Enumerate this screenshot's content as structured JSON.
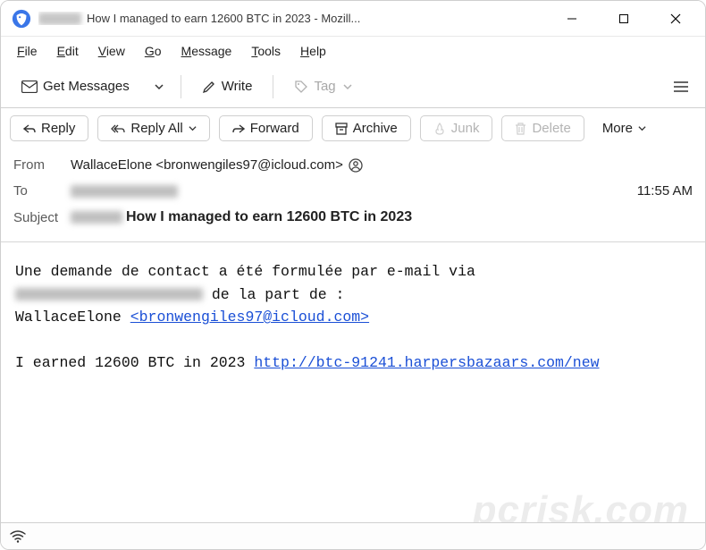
{
  "window": {
    "title_suffix": "How I managed to earn 12600 BTC in 2023 - Mozill..."
  },
  "menubar": {
    "file": "File",
    "edit": "Edit",
    "view": "View",
    "go": "Go",
    "message": "Message",
    "tools": "Tools",
    "help": "Help"
  },
  "toolbar1": {
    "get_messages": "Get Messages",
    "write": "Write",
    "tag": "Tag"
  },
  "toolbar2": {
    "reply": "Reply",
    "reply_all": "Reply All",
    "forward": "Forward",
    "archive": "Archive",
    "junk": "Junk",
    "delete": "Delete",
    "more": "More"
  },
  "headers": {
    "from_label": "From",
    "from_value": "WallaceElone <bronwengiles97@icloud.com>",
    "to_label": "To",
    "timestamp": "11:55 AM",
    "subject_label": "Subject",
    "subject_value": "How I managed to earn 12600 BTC in 2023"
  },
  "body": {
    "line1": "Une demande de contact a été formulée par e-mail via",
    "line2_suffix": " de la part de :",
    "line3_prefix": "WallaceElone ",
    "line3_link": "<bronwengiles97@icloud.com>",
    "line4_prefix": "I earned 12600 BTC in 2023 ",
    "line4_link": "http://btc-91241.harpersbazaars.com/new"
  },
  "watermark": "pcrisk.com"
}
